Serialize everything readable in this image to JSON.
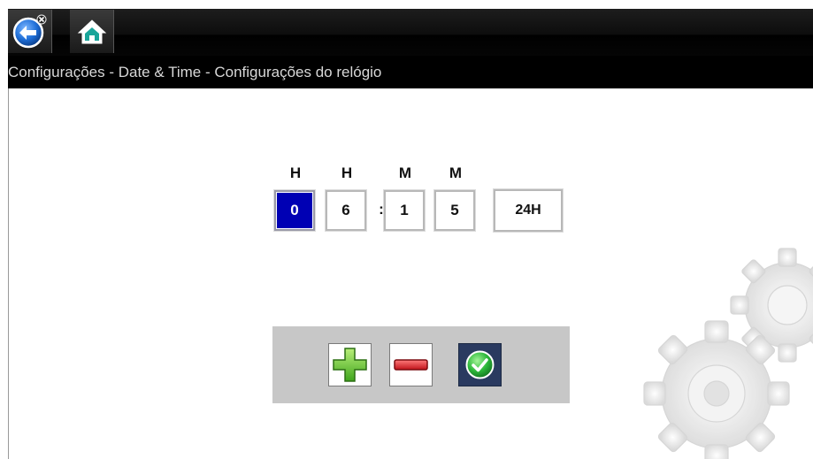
{
  "header": {
    "back_icon": "back-arrow-icon",
    "home_icon": "home-icon"
  },
  "breadcrumb": "Configurações - Date & Time - Configurações do relógio",
  "time_editor": {
    "column_labels": [
      "H",
      "H",
      "M",
      "M"
    ],
    "digits": [
      "0",
      "6",
      "1",
      "5"
    ],
    "selected_index": 0,
    "separator": ":",
    "mode_label": "24H"
  },
  "actions": {
    "plus_icon": "plus-icon",
    "minus_icon": "minus-icon",
    "confirm_icon": "checkmark-icon"
  },
  "colors": {
    "selected_digit": "#0000b4",
    "plus_green": "#5cc22e",
    "minus_red": "#d8232a",
    "confirm_green": "#2db83a",
    "confirm_bg": "#2a3a60"
  }
}
